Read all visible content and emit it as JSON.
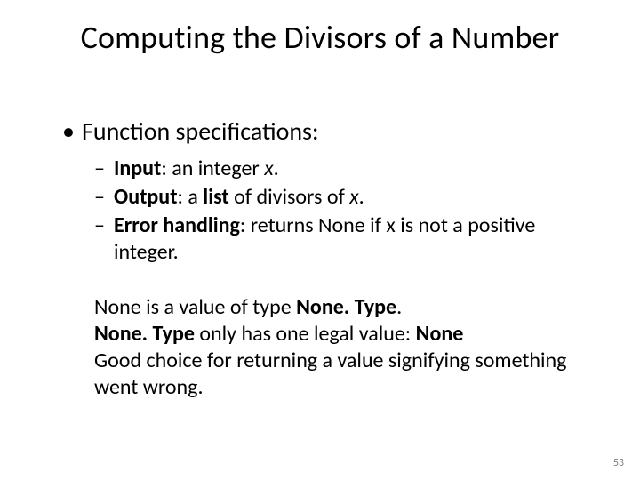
{
  "title": "Computing the Divisors of a Number",
  "bullet_marker": "•",
  "dash_marker": "–",
  "top_bullet": "Function specifications:",
  "items": {
    "input": {
      "label": "Input",
      "text": ": an integer ",
      "var": "x",
      "after": "."
    },
    "output": {
      "label": "Output",
      "text": ": a ",
      "emph": "list",
      "rest": " of divisors of ",
      "var": "x",
      "after": "."
    },
    "error": {
      "label": "Error handling",
      "text": ": returns None if x is not a positive integer."
    }
  },
  "notes": {
    "l1a": "None is a value of type ",
    "l1b": "None. Type",
    "l1c": ".",
    "l2a": "None. Type",
    "l2b": " only has one legal value: ",
    "l2c": "None",
    "l3": "Good choice for returning a value signifying something went wrong."
  },
  "page_number": "53"
}
